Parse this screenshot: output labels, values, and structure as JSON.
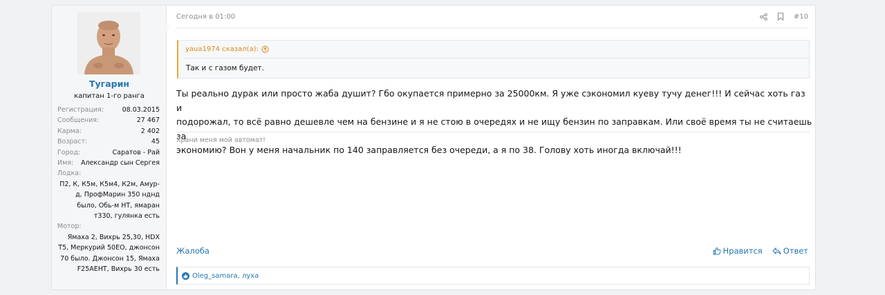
{
  "post": {
    "user": {
      "name": "Тугарин",
      "title": "капитан 1-го ранга",
      "stats": [
        {
          "label": "Регистрация:",
          "value": "08.03.2015"
        },
        {
          "label": "Сообщения:",
          "value": "27 467"
        },
        {
          "label": "Карма:",
          "value": "2 402"
        },
        {
          "label": "Возраст:",
          "value": "45"
        },
        {
          "label": "Город:",
          "value": "Саратов - Рай"
        },
        {
          "label": "Имя:",
          "value": "Александр сын Сергея"
        }
      ],
      "boat_label": "Лодка:",
      "boat_value": "П2, К, К5м, К5м4, К2м, Амур-д, ПрофМарин 350 нднд было, Обь-м НТ, ямаран т330, гулянка есть",
      "motor_label": "Мотор:",
      "motor_value": "Ямаха 2, Вихрь 25,30, HDX T5, Меркурий 50EO, джонсон 70 было. Джонсон 15, Ямаха F25AEHT, Вихрь 30 есть"
    },
    "date": "Сегодня в 01:00",
    "number": "#10",
    "share_icon": "share-icon",
    "bookmark_icon": "bookmark-icon",
    "quote": {
      "author": "yaua1974 сказал(а):",
      "text": "Так и с газом будет."
    },
    "message_lines": [
      "Ты реально дурак или просто жаба душит? Гбо окупается примерно за 25000км. Я уже сэкономил куеву тучу денег!!! И сейчас хоть газ и",
      "подорожал, то всё равно дешевле чем на бензине и я не стою в очередях и не ищу бензин по заправкам. Или своё время ты не считаешь за",
      "экономию? Вон у меня начальник по 140 заправляется без очереди, а я по 38. Голову хоть иногда включай!!!"
    ],
    "signature": "Храни меня мой автомат!",
    "report_label": "Жалоба",
    "like_label": "Нравится",
    "reply_label": "Ответ",
    "reactions": "Oleg_samara, луха"
  },
  "colors": {
    "link": "#2577b1",
    "quote_accent": "#f0a733",
    "muted": "#8c8c8c"
  }
}
